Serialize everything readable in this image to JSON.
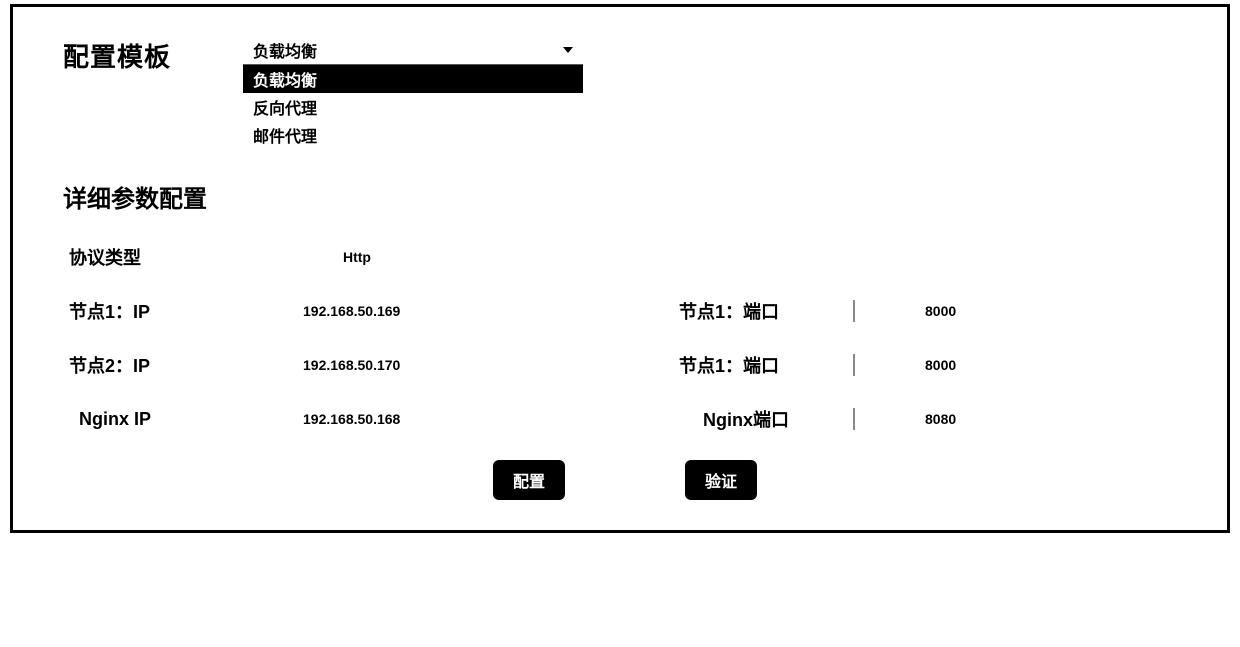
{
  "header": {
    "config_template_label": "配置模板"
  },
  "template_select": {
    "selected": "负载均衡",
    "options": [
      "负载均衡",
      "反向代理",
      "邮件代理"
    ],
    "highlighted_index": 0
  },
  "section_detail_label": "详细参数配置",
  "params": {
    "protocol_label": "协议类型",
    "protocol_value": "Http",
    "node1_ip_label": "节点1：IP",
    "node1_ip_value": "192.168.50.169",
    "node1_port_label": "节点1：端口",
    "node1_port_value": "8000",
    "node2_ip_label": "节点2：IP",
    "node2_ip_value": "192.168.50.170",
    "node2_port_label": "节点1：端口",
    "node2_port_value": "8000",
    "nginx_ip_label": "Nginx IP",
    "nginx_ip_value": "192.168.50.168",
    "nginx_port_label": "Nginx端口",
    "nginx_port_value": "8080"
  },
  "buttons": {
    "config": "配置",
    "verify": "验证"
  }
}
